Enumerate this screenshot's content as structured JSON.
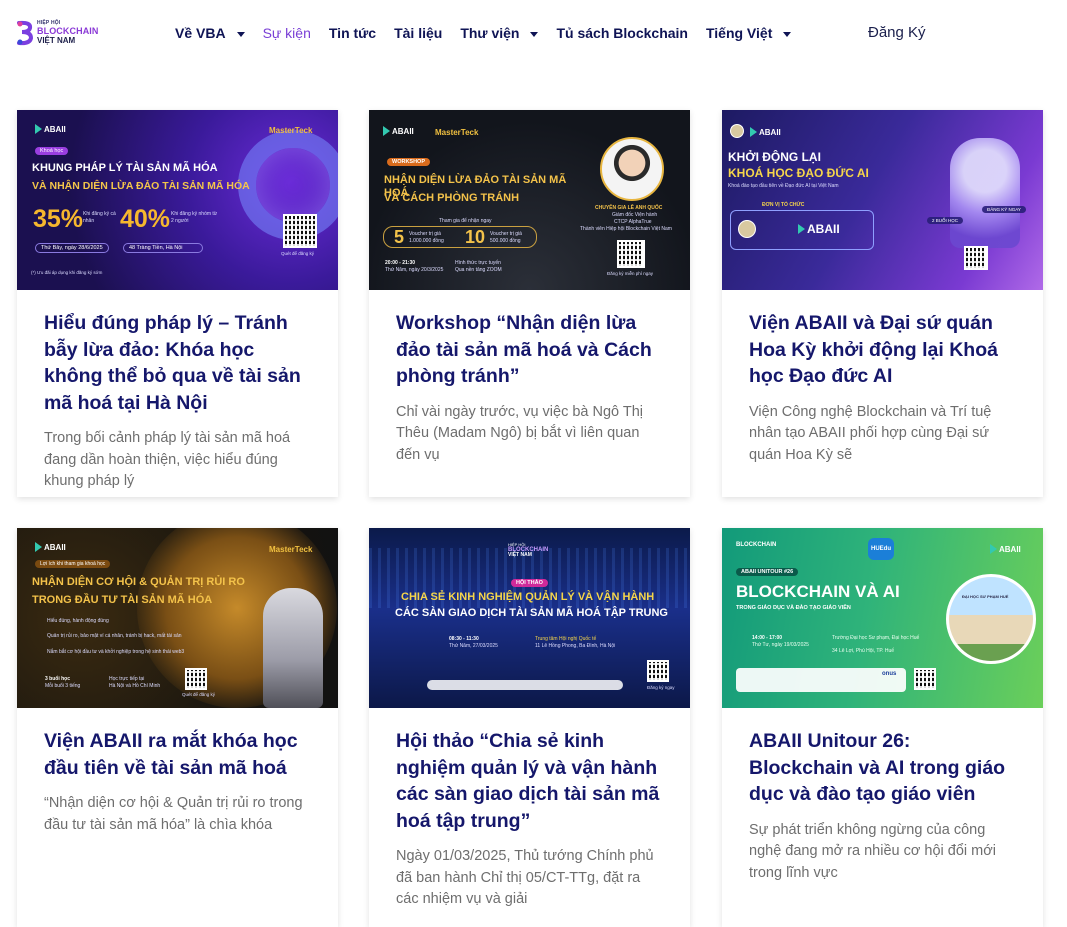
{
  "logo": {
    "line1": "HIỆP HỘI",
    "line2": "BLOCKCHAIN",
    "line3": "VIỆT NAM"
  },
  "nav": [
    {
      "label": "Về VBA",
      "dropdown": true,
      "active": false
    },
    {
      "label": "Sự kiện",
      "dropdown": false,
      "active": true
    },
    {
      "label": "Tin tức",
      "dropdown": false,
      "active": false
    },
    {
      "label": "Tài liệu",
      "dropdown": false,
      "active": false
    },
    {
      "label": "Thư viện",
      "dropdown": true,
      "active": false
    },
    {
      "label": "Tủ sách Blockchain",
      "dropdown": false,
      "active": false
    },
    {
      "label": "Tiếng Việt",
      "dropdown": true,
      "active": false
    }
  ],
  "register_label": "Đăng Ký",
  "colors": {
    "accent": "#7a3fd6",
    "title": "#15176b",
    "nav": "#0f1455",
    "excerpt": "#6e6e6e"
  },
  "posts": [
    {
      "title": "Hiểu đúng pháp lý – Tránh bẫy lừa đảo: Khóa học không thể bỏ qua về tài sản mã hoá tại Hà Nội",
      "excerpt": "Trong bối cảnh pháp lý tài sản mã hoá đang dần hoàn thiện, việc hiểu đúng khung pháp lý",
      "thumb": {
        "logo": "ABAII",
        "partner": "MasterTeck",
        "tag": "Khoá học",
        "headline1": "KHUNG PHÁP LÝ TÀI SẢN MÃ HÓA",
        "headline2": "VÀ NHẬN DIỆN LỪA ĐẢO TÀI SẢN MÃ HÓA",
        "discount1": "35%",
        "discount1_note": "Khi đăng ký cá nhân",
        "discount2": "40%",
        "discount2_note": "Khi đăng ký nhóm từ 2 người",
        "date": "Thứ Bảy, ngày 28/6/2025",
        "place": "48 Tràng Tiền, Hà Nội",
        "qr_caption": "Quét để đăng ký",
        "footnote": "(*) Ưu đãi áp dụng khi đăng ký sớm"
      }
    },
    {
      "title": "Workshop “Nhận diện lừa đảo tài sản mã hoá và Cách phòng tránh”",
      "excerpt": "Chỉ vài ngày trước, vụ việc bà Ngô Thị Thêu (Madam Ngô) bị bắt vì liên quan đến vụ",
      "thumb": {
        "logo": "ABAII",
        "partner": "MasterTeck",
        "tag": "WORKSHOP",
        "headline1": "NHẬN DIỆN LỪA ĐẢO TÀI SẢN MÃ HOÁ",
        "headline2": "VÀ CÁCH PHÒNG TRÁNH",
        "gift_note": "Tham gia để nhận ngay",
        "voucher1": "5",
        "voucher1_note": "Voucher trị giá 1.000.000 đồng",
        "voucher2": "10",
        "voucher2_note": "Voucher trị giá 500.000 đồng",
        "time": "20:00 - 21:30",
        "date": "Thứ Năm, ngày 20/3/2025",
        "format": "Hình thức trực tuyến",
        "platform": "Qua nền tảng ZOOM",
        "speaker_role": "CHUYÊN GIA LÊ ANH QUỐC",
        "speaker_desc1": "Giám đốc Viện hành",
        "speaker_desc2": "CTCP AlphaTrue",
        "speaker_desc3": "Thành viên Hiệp hội Blockchain Việt Nam",
        "qr_caption": "Đăng ký miễn phí ngay"
      }
    },
    {
      "title": "Viện ABAII và Đại sứ quán Hoa Kỳ khởi động lại Khoá học Đạo đức AI",
      "excerpt": "Viện Công nghệ Blockchain và Trí tuệ nhân tạo ABAII phối hợp cùng Đại sứ quán Hoa Kỳ sẽ",
      "thumb": {
        "logo": "ABAII",
        "headline1": "KHỞI ĐỘNG LẠI",
        "headline2": "KHOÁ HỌC ĐẠO ĐỨC AI",
        "subline": "Khoá đào tạo đầu tiên về Đạo đức AI tại Việt Nam",
        "org_label": "ĐƠN VỊ TỔ CHỨC",
        "org_name": "ABAII",
        "badge1": "2 BUỔI HỌC",
        "badge2": "ĐĂNG KÝ NGAY"
      }
    },
    {
      "title": "Viện ABAII ra mắt khóa học đầu tiên về tài sản mã hoá",
      "excerpt": "“Nhận diện cơ hội & Quản trị rủi ro trong đầu tư tài sản mã hóa” là chìa khóa",
      "thumb": {
        "logo": "ABAII",
        "partner": "MasterTeck",
        "tag": "Lợi ích khi tham gia khoá học",
        "headline1": "NHẬN DIỆN CƠ HỘI & QUẢN TRỊ RỦI RO",
        "headline2": "TRONG ĐẦU TƯ TÀI SẢN MÃ HÓA",
        "bullets": [
          "Hiểu đúng, hành động đúng",
          "Quản trị rủi ro, bảo mật ví cá nhân, tránh bị hack, mất tài sản",
          "Nắm bắt cơ hội đầu tư và khởi nghiệp trong hệ sinh thái web3"
        ],
        "sessions": "3 buổi học",
        "session_len": "Mỗi buổi 3 tiếng",
        "mode": "Học trực tiếp tại",
        "cities": "Hà Nội và Hồ Chí Minh",
        "qr_caption": "Quét để đăng ký"
      }
    },
    {
      "title": "Hội thảo “Chia sẻ kinh nghiệm quản lý và vận hành các sàn giao dịch tài sản mã hoá tập trung”",
      "excerpt": "Ngày 01/03/2025, Thủ tướng Chính phủ đã ban hành Chỉ thị 05/CT-TTg, đặt ra các nhiệm vụ và giải",
      "thumb": {
        "logo1": "HIỆP HỘI",
        "logo2": "BLOCKCHAIN",
        "logo3": "VIỆT NAM",
        "tag": "HỘI THẢO",
        "headline1": "CHIA SẺ KINH NGHIỆM QUẢN LÝ VÀ VẬN HÀNH",
        "headline2": "CÁC SÀN GIAO DỊCH TÀI SẢN MÃ HOÁ TẬP TRUNG",
        "time": "08:30 - 11:30",
        "date": "Thứ Năm, 27/03/2025",
        "venue": "Trung tâm Hội nghị Quốc tế",
        "address": "11 Lê Hồng Phong, Ba Đình, Hà Nội",
        "qr_caption": "Đăng ký ngay"
      }
    },
    {
      "title": "ABAII Unitour 26: Blockchain và AI trong giáo dục và đào tạo giáo viên",
      "excerpt": "Sự phát triển không ngừng của công nghệ đang mở ra nhiều cơ hội đổi mới trong lĩnh vực",
      "thumb": {
        "logo": "ABAII",
        "logo_vba": "BLOCKCHAIN",
        "host": "HUEdu",
        "tag": "ABAII UNITOUR #26",
        "headline1": "BLOCKCHAIN VÀ AI",
        "headline2": "TRONG GIÁO DỤC VÀ ĐÀO TẠO GIÁO VIÊN",
        "time": "14:00 - 17:00",
        "date": "Thứ Tư, ngày 19/03/2025",
        "venue": "Trường Đại học Sư phạm, Đại học Huế",
        "address": "34 Lê Lợi, Phú Hội, TP. Huế",
        "building_sign": "ĐẠI HỌC SƯ PHẠM HUẾ",
        "sponsor": "onus"
      }
    }
  ]
}
